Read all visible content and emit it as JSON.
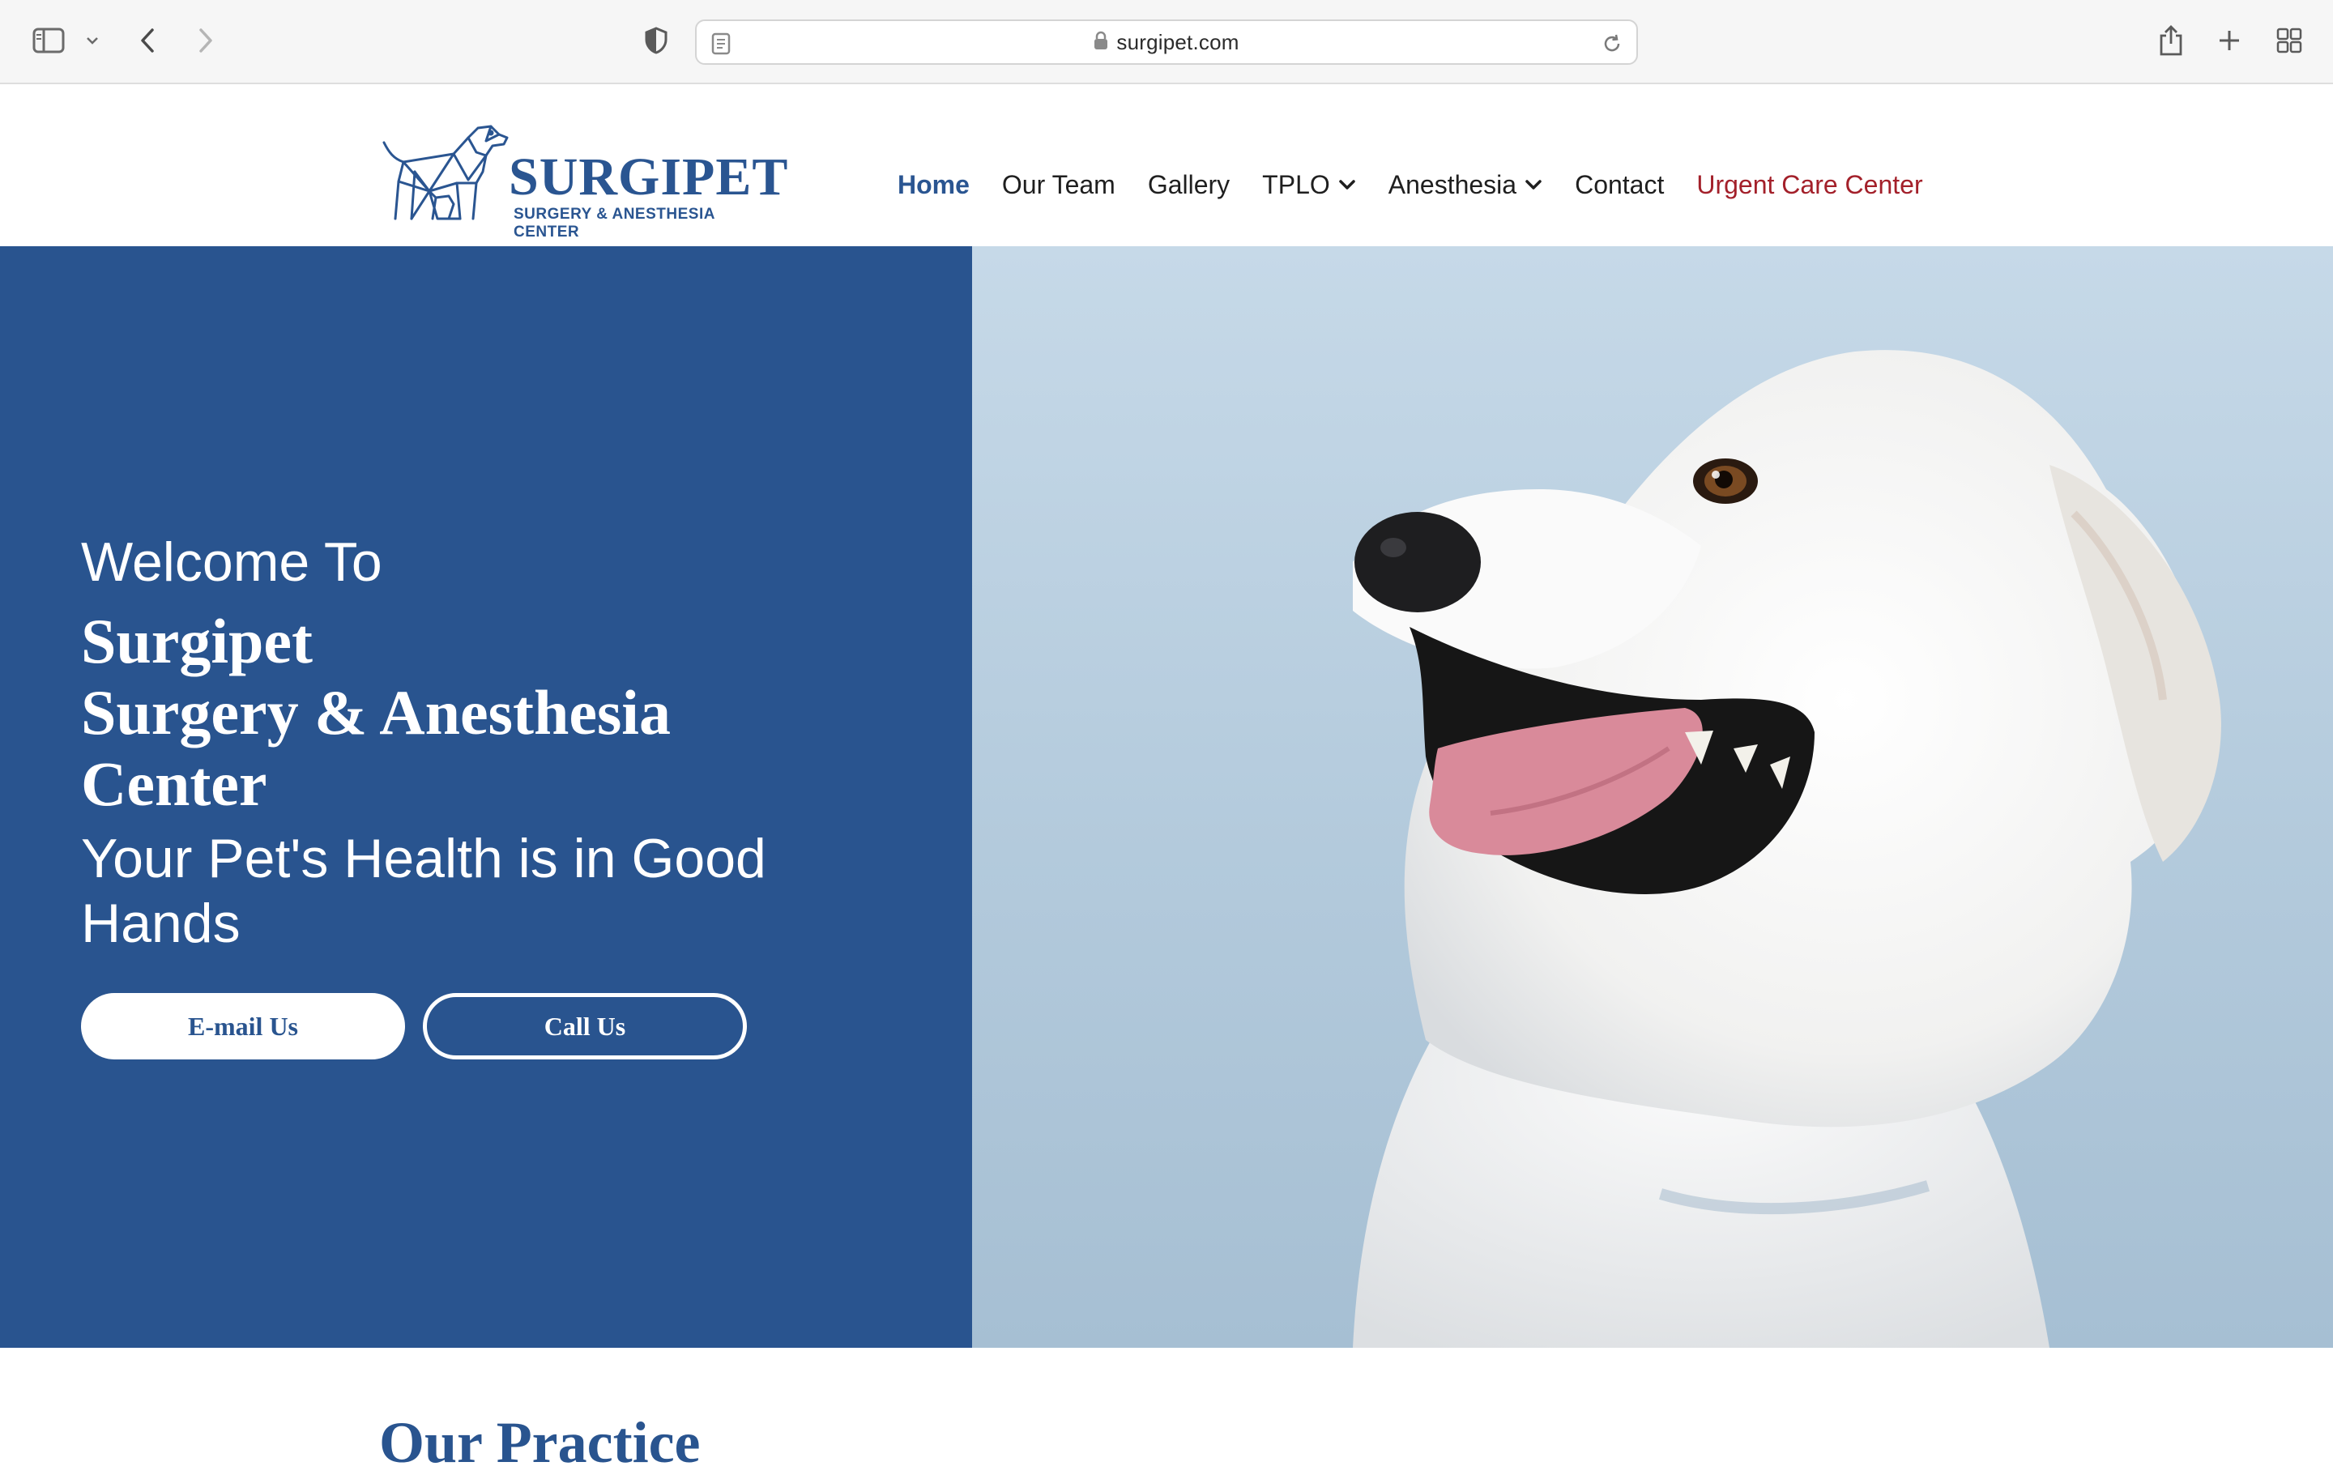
{
  "browser": {
    "url": "surgipet.com",
    "icons": [
      "sidebar-icon",
      "chevron-down-icon",
      "back-arrow-icon",
      "forward-arrow-icon",
      "shield-icon",
      "reader-icon",
      "lock-icon",
      "reload-icon",
      "share-icon",
      "plus-icon",
      "tab-grid-icon"
    ]
  },
  "header": {
    "logo": {
      "wordmark": "SURGIPET",
      "tagline": "SURGERY & ANESTHESIA CENTER"
    },
    "nav": [
      {
        "label": "Home",
        "active": true
      },
      {
        "label": "Our Team"
      },
      {
        "label": "Gallery"
      },
      {
        "label": "TPLO",
        "dropdown": true
      },
      {
        "label": "Anesthesia",
        "dropdown": true
      },
      {
        "label": "Contact"
      },
      {
        "label": "Urgent Care Center",
        "accent": "#a3202a"
      }
    ]
  },
  "hero": {
    "welcome": "Welcome To",
    "title_line1": "Surgipet",
    "title_line2": "Surgery & Anesthesia",
    "title_line3": "Center",
    "subtitle": "Your Pet's Health is in Good Hands",
    "buttons": {
      "email": "E-mail Us",
      "call": "Call Us"
    },
    "image_subject": "white-dog-photo"
  },
  "practice": {
    "heading": "Our Practice"
  },
  "colors": {
    "brand_blue": "#29548f",
    "urgent_red": "#a3202a",
    "hero_photo_bg": "#b9cfe0"
  }
}
